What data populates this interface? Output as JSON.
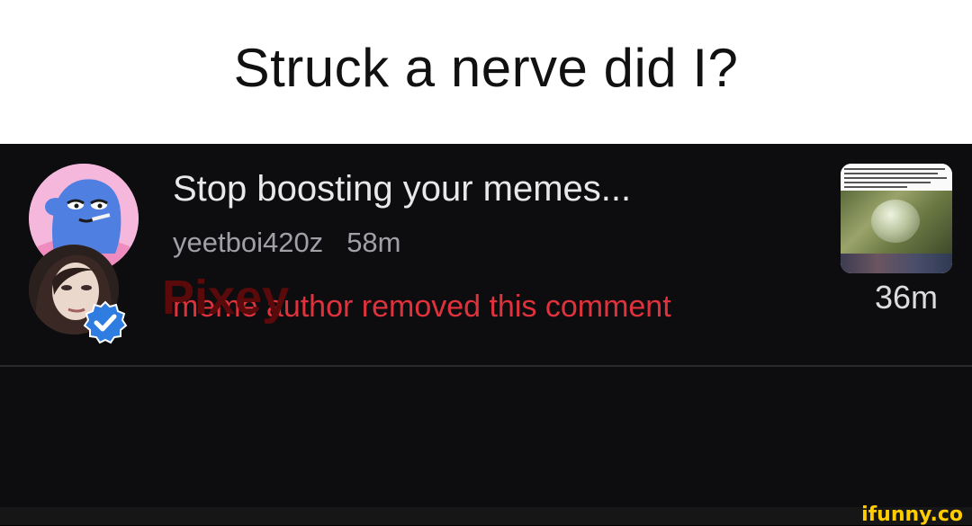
{
  "caption": {
    "text": "Struck a nerve did I?"
  },
  "comment1": {
    "title": "Stop boosting your memes...",
    "username": "yeetboi420z",
    "time": "58m",
    "status": "meme author removed this comment",
    "avatar_icon": "blue-cartoon-avatar",
    "thumbnail_icon": "meme-thumbnail"
  },
  "comment2": {
    "name": "Pixey",
    "time": "36m",
    "avatar_icon": "profile-photo-avatar",
    "badge_icon": "verified-check-icon"
  },
  "watermark": "ifunny.co",
  "colors": {
    "removed_text": "#e0323c",
    "name_red": "#5a0a0a",
    "badge_blue": "#2f7de1",
    "background": "#0d0d0f"
  }
}
